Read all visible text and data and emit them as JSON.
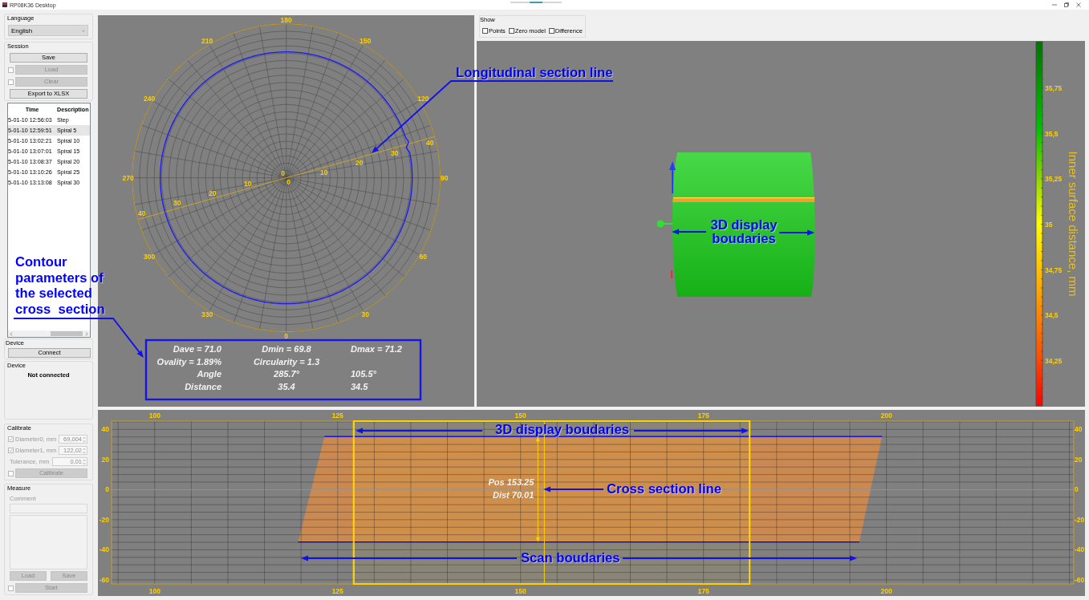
{
  "window": {
    "title": "RP08K36 Desktop"
  },
  "sidebar": {
    "language": {
      "label": "Language",
      "value": "English"
    },
    "session": {
      "label": "Session",
      "buttons": [
        {
          "kind": "button",
          "label": "Save",
          "disabled": false
        },
        {
          "kind": "check_button",
          "label": "Load",
          "disabled": true,
          "checked": false
        },
        {
          "kind": "check_button",
          "label": "Clear",
          "disabled": true,
          "checked": false
        },
        {
          "kind": "button",
          "label": "Export to XLSX",
          "disabled": false
        }
      ]
    },
    "table": {
      "columns": [
        "Time",
        "Description"
      ],
      "rows": [
        {
          "time": "5-01-10 12:56:03",
          "description": "Step",
          "selected": false
        },
        {
          "time": "5-01-10 12:59:51",
          "description": "Spiral 5",
          "selected": true
        },
        {
          "time": "5-01-10 13:02:21",
          "description": "Spiral 10",
          "selected": false
        },
        {
          "time": "5-01-10 13:07:01",
          "description": "Spiral 15",
          "selected": false
        },
        {
          "time": "5-01-10 13:08:37",
          "description": "Spiral 20",
          "selected": false
        },
        {
          "time": "5-01-10 13:10:26",
          "description": "Spiral 25",
          "selected": false
        },
        {
          "time": "5-01-10 13:13:08",
          "description": "Spiral 30",
          "selected": false
        }
      ]
    },
    "device": {
      "label": "Device",
      "button": {
        "label": "Connect",
        "disabled": false
      }
    },
    "device_status": {
      "label": "Device",
      "status": "Not connected"
    },
    "calibrate": {
      "label": "Calibrate",
      "fields": [
        {
          "kind": "check_spin",
          "label": "Diameter0, mm",
          "value": "69,004",
          "checked": true,
          "disabled": true
        },
        {
          "kind": "check_spin",
          "label": "Diameter1, mm",
          "value": "122,02",
          "checked": true,
          "disabled": true
        },
        {
          "kind": "spin",
          "label": "Tolerance, mm",
          "value": "0,01",
          "disabled": true
        }
      ],
      "button": {
        "label": "Calibrate",
        "disabled": true,
        "checked": false
      }
    },
    "measure": {
      "label": "Measure",
      "comment_label": "Comment",
      "disabled": true,
      "buttons": [
        {
          "label": "Load",
          "disabled": true
        },
        {
          "label": "Save",
          "disabled": true
        }
      ],
      "start": {
        "label": "Start",
        "disabled": true,
        "checked": false
      }
    }
  },
  "show_options": {
    "label": "Show",
    "options": [
      {
        "label": "Points",
        "checked": false
      },
      {
        "label": "Zero model",
        "checked": false
      },
      {
        "label": "Difference",
        "checked": false
      }
    ]
  },
  "polar_plot": {
    "angle_labels": [
      "0",
      "30",
      "60",
      "90",
      "120",
      "150",
      "180",
      "210",
      "240",
      "270",
      "300",
      "330"
    ],
    "section_line": {
      "forward_labels": [
        "0",
        "10",
        "20",
        "30",
        "40"
      ],
      "backward_labels": [
        "0",
        "10",
        "20",
        "30",
        "40"
      ]
    },
    "parameters": [
      {
        "cells": [
          "Dave = 71.0",
          "Dmin = 69.8",
          "Dmax = 71.2"
        ]
      },
      {
        "cells": [
          "Ovality = 1.89%",
          "Circularity = 1.3"
        ]
      },
      {
        "cells": [
          "Angle",
          "285.7°",
          "105.5°"
        ]
      },
      {
        "cells": [
          "Distance",
          "35.4",
          "34.5"
        ]
      }
    ]
  },
  "model_view": {
    "colorbar": {
      "title": "Inner surface distance, mm",
      "ticks": [
        "35,75",
        "35,5",
        "35,25",
        "35",
        "34,75",
        "34,5",
        "34,25"
      ]
    }
  },
  "profile_chart": {
    "chart_data": {
      "type": "line",
      "x": [
        119.6,
        123.2,
        196.3,
        199.4
      ],
      "series": [
        {
          "color": "#0000ff",
          "values": [
            null,
            35.3,
            35.3,
            35.3
          ]
        },
        {
          "color": "#0000ff",
          "values": [
            -34.8,
            -34.8,
            -34.8,
            null
          ]
        }
      ],
      "xlim": [
        94.1,
        225.6
      ],
      "ylim": [
        -62.7,
        45.5
      ],
      "xticks": [
        100,
        125,
        150,
        175,
        200
      ],
      "yticks": [
        40,
        20,
        0,
        -20,
        -40,
        -60
      ],
      "grid": true,
      "bands": [
        {
          "axis": "x",
          "from": 127.2,
          "to": 181.3
        }
      ],
      "ref_lines": [
        {
          "axis": "x",
          "value": 153.25
        }
      ],
      "annotations": [
        {
          "x": 153.25,
          "y": 2.8,
          "text": "Pos 153.25"
        },
        {
          "x": 153.25,
          "y": -5.7,
          "text": "Dist 70.01"
        }
      ]
    },
    "bottom_tick_labels": [
      "100",
      "125",
      "150",
      "175",
      "200"
    ],
    "left_tick_labels": [
      "40",
      "20",
      "0",
      "-20",
      "-40",
      "-60"
    ]
  },
  "callouts": [
    {
      "text": "Longitudinal section line"
    },
    {
      "text": "3D display boudaries"
    },
    {
      "text": "Contour parameters of the selected cross  section"
    },
    {
      "text": "3D display boudaries"
    },
    {
      "text": "Cross section line"
    },
    {
      "text": "Scan boudaries"
    }
  ]
}
